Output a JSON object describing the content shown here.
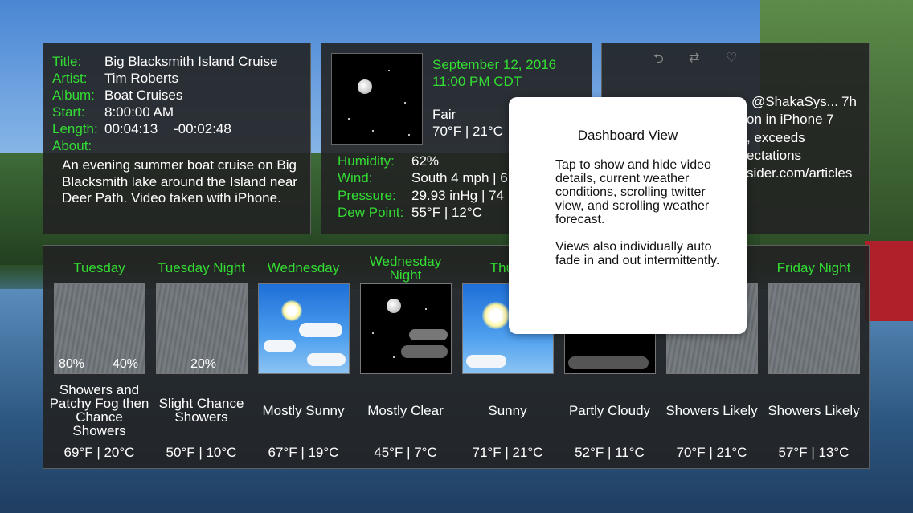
{
  "video": {
    "labels": {
      "title": "Title:",
      "artist": "Artist:",
      "album": "Album:",
      "start": "Start:",
      "length": "Length:",
      "about": "About:"
    },
    "title": "Big Blacksmith Island Cruise",
    "artist": "Tim Roberts",
    "album": "Boat Cruises",
    "start": "8:00:00 AM",
    "length": "00:04:13",
    "remaining": "-00:02:48",
    "about": "An evening summer boat cruise on Big Blacksmith lake around the Island near Deer Path. Video taken with iPhone."
  },
  "current": {
    "date": "September 12, 2016",
    "time": "11:00 PM CDT",
    "condition": "Fair",
    "temp": "70°F | 21°C",
    "labels": {
      "humidity": "Humidity:",
      "wind": "Wind:",
      "pressure": "Pressure:",
      "dewpoint": "Dew Point:"
    },
    "humidity": "62%",
    "wind": "South 4 mph | 6",
    "pressure": "29.93 inHg | 74",
    "dewpoint": "55°F | 12°C"
  },
  "twitter": {
    "icons": [
      "reply-icon",
      "retweet-icon",
      "heart-icon"
    ],
    "handle": "@ShakaSys...",
    "age": "7h",
    "lines": [
      "on in iPhone 7",
      ", exceeds",
      "ectations"
    ],
    "link": "sider.com/articles"
  },
  "forecast": [
    {
      "day": "Tuesday",
      "cond": "Showers and Patchy Fog then Chance Showers",
      "temp": "69°F | 20°C",
      "pct": [
        "80%",
        "40%"
      ],
      "icon": "rain-split"
    },
    {
      "day": "Tuesday Night",
      "cond": "Slight Chance Showers",
      "temp": "50°F | 10°C",
      "pct": [
        "20%"
      ],
      "icon": "rain"
    },
    {
      "day": "Wednesday",
      "cond": "Mostly Sunny",
      "temp": "67°F | 19°C",
      "pct": [],
      "icon": "sunny-clouds"
    },
    {
      "day": "Wednesday Night",
      "cond": "Mostly Clear",
      "temp": "45°F | 7°C",
      "pct": [],
      "icon": "night-clouds"
    },
    {
      "day": "Thurs",
      "cond": "Sunny",
      "temp": "71°F | 21°C",
      "pct": [],
      "icon": "sunny"
    },
    {
      "day": "",
      "cond": "Partly Cloudy",
      "temp": "52°F | 11°C",
      "pct": [],
      "icon": "night-partly"
    },
    {
      "day": "",
      "cond": "Showers Likely",
      "temp": "70°F | 21°C",
      "pct": [],
      "icon": "rain"
    },
    {
      "day": "Friday Night",
      "cond": "Showers Likely",
      "temp": "57°F | 13°C",
      "pct": [],
      "icon": "rain"
    }
  ],
  "popup": {
    "title": "Dashboard View",
    "body1": "Tap to show and hide video details, current weather conditions, scrolling twitter view, and scrolling weather forecast.",
    "body2": "Views also individually auto fade in and out intermittently."
  }
}
